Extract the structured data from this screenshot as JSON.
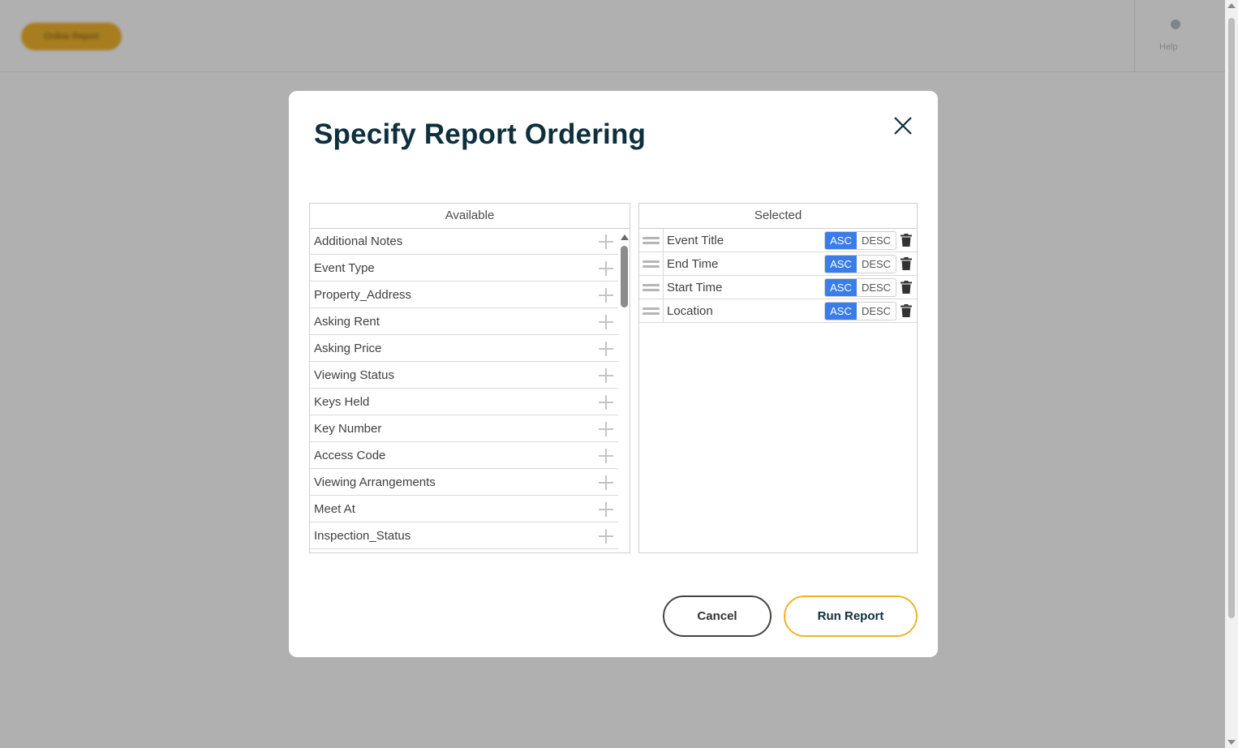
{
  "background": {
    "header_button_label": "Online Report",
    "right_label": "Help"
  },
  "modal": {
    "title": "Specify Report Ordering",
    "available": {
      "header": "Available",
      "items": [
        "Additional Notes",
        "Event Type",
        "Property_Address",
        "Asking Rent",
        "Asking Price",
        "Viewing Status",
        "Keys Held",
        "Key Number",
        "Access Code",
        "Viewing Arrangements",
        "Meet At",
        "Inspection_Status"
      ]
    },
    "selected": {
      "header": "Selected",
      "items": [
        {
          "label": "Event Title",
          "asc": "ASC",
          "desc": "DESC",
          "active": "ASC"
        },
        {
          "label": "End Time",
          "asc": "ASC",
          "desc": "DESC",
          "active": "ASC"
        },
        {
          "label": "Start Time",
          "asc": "ASC",
          "desc": "DESC",
          "active": "ASC"
        },
        {
          "label": "Location",
          "asc": "ASC",
          "desc": "DESC",
          "active": "ASC"
        }
      ]
    },
    "buttons": {
      "cancel": "Cancel",
      "run": "Run Report"
    }
  },
  "colors": {
    "accent_blue": "#3b7de8",
    "accent_gold": "#f0b323",
    "title_navy": "#0e2f3c"
  },
  "icons": {
    "close": "close-icon",
    "add": "plus-icon",
    "drag": "drag-handle-icon",
    "delete": "trash-icon"
  }
}
